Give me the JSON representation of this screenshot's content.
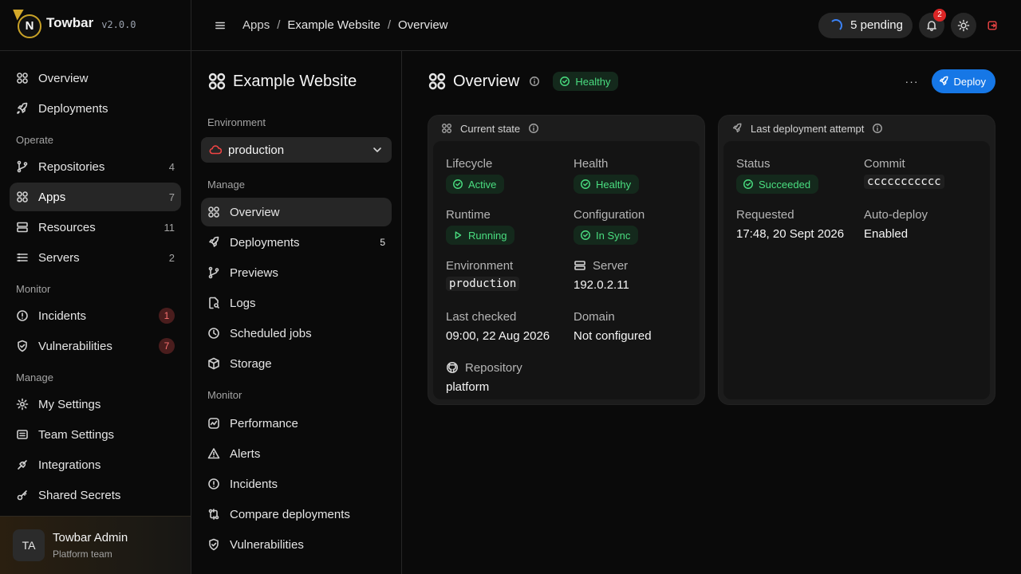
{
  "brand": {
    "logo_letter": "N",
    "name": "Towbar",
    "version": "v2.0.0"
  },
  "sidebar": {
    "top_items": [
      {
        "label": "Overview",
        "icon": "overview-grid-icon"
      },
      {
        "label": "Deployments",
        "icon": "rocket-icon"
      }
    ],
    "sections": {
      "operate": "Operate",
      "monitor": "Monitor",
      "manage": "Manage"
    },
    "operate_items": [
      {
        "label": "Repositories",
        "count": "4",
        "icon": "git-branch-icon"
      },
      {
        "label": "Apps",
        "count": "7",
        "icon": "apps-grid-icon",
        "active": true
      },
      {
        "label": "Resources",
        "count": "11",
        "icon": "database-icon"
      },
      {
        "label": "Servers",
        "count": "2",
        "icon": "server-icon"
      }
    ],
    "monitor_items": [
      {
        "label": "Incidents",
        "count": "1",
        "icon": "alert-circle-icon"
      },
      {
        "label": "Vulnerabilities",
        "count": "7",
        "icon": "shield-icon"
      }
    ],
    "manage_items": [
      {
        "label": "My Settings",
        "icon": "gear-icon"
      },
      {
        "label": "Team Settings",
        "icon": "team-icon"
      },
      {
        "label": "Integrations",
        "icon": "plug-icon"
      },
      {
        "label": "Shared Secrets",
        "icon": "key-icon"
      }
    ]
  },
  "user": {
    "initials": "TA",
    "name": "Towbar Admin",
    "team": "Platform team"
  },
  "topbar": {
    "breadcrumbs": [
      "Apps",
      "Example Website",
      "Overview"
    ],
    "separator": "/",
    "pending_label": "5 pending",
    "notifications_count": "2"
  },
  "subnav": {
    "app_name": "Example Website",
    "environment_label": "Environment",
    "environment_value": "production",
    "manage_label": "Manage",
    "manage_items": [
      {
        "label": "Overview",
        "icon": "overview-grid-icon",
        "active": true
      },
      {
        "label": "Deployments",
        "icon": "rocket-icon",
        "count": "5"
      },
      {
        "label": "Previews",
        "icon": "git-branch-icon"
      },
      {
        "label": "Logs",
        "icon": "file-search-icon"
      },
      {
        "label": "Scheduled jobs",
        "icon": "clock-icon"
      },
      {
        "label": "Storage",
        "icon": "box-icon"
      }
    ],
    "monitor_label": "Monitor",
    "monitor_items": [
      {
        "label": "Performance",
        "icon": "activity-icon"
      },
      {
        "label": "Alerts",
        "icon": "warning-triangle-icon"
      },
      {
        "label": "Incidents",
        "icon": "alert-circle-icon"
      },
      {
        "label": "Compare deployments",
        "icon": "compare-icon"
      },
      {
        "label": "Vulnerabilities",
        "icon": "shield-icon"
      }
    ]
  },
  "main": {
    "title": "Overview",
    "health_badge": "Healthy",
    "more_label": "···",
    "deploy_label": "Deploy",
    "current_state": {
      "title": "Current state",
      "lifecycle_label": "Lifecycle",
      "lifecycle_value": "Active",
      "health_label": "Health",
      "health_value": "Healthy",
      "runtime_label": "Runtime",
      "runtime_value": "Running",
      "configuration_label": "Configuration",
      "configuration_value": "In Sync",
      "environment_label": "Environment",
      "environment_value": "production",
      "server_label": "Server",
      "server_value": "192.0.2.11",
      "last_checked_label": "Last checked",
      "last_checked_value": "09:00, 22 Aug 2026",
      "domain_label": "Domain",
      "domain_value": "Not configured",
      "repository_label": "Repository",
      "repository_value": "platform"
    },
    "last_deployment": {
      "title": "Last deployment attempt",
      "status_label": "Status",
      "status_value": "Succeeded",
      "commit_label": "Commit",
      "commit_value": "ccccccccccc",
      "requested_label": "Requested",
      "requested_value": "17:48, 20 Sept 2026",
      "autodeploy_label": "Auto-deploy",
      "autodeploy_value": "Enabled"
    }
  },
  "colors": {
    "accent": "#1677e6",
    "success": "#4ade80",
    "danger": "#ef4444",
    "brand_gold": "#c9a227"
  }
}
